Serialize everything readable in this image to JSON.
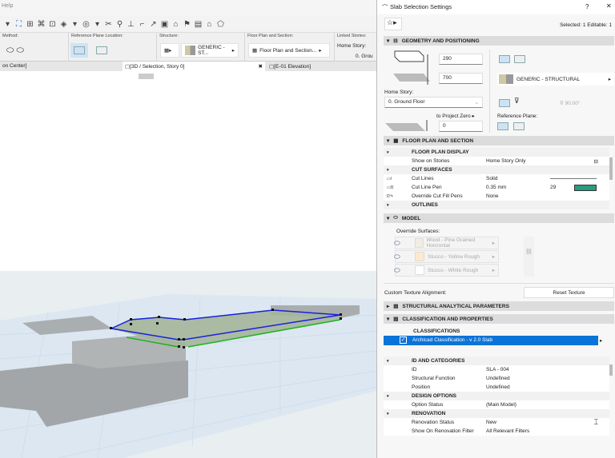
{
  "app": {
    "menu": [
      "Help"
    ],
    "infobox": {
      "method_label": "Method:",
      "ref_plane_label": "Reference Plane Location:",
      "structure_label": "Structure:",
      "structure_value": "GENERIC - ST...",
      "fps_label": "Floor Plan and Section:",
      "fps_value": "Floor Plan and Section...",
      "linked_label": "Linked Stories:",
      "home_story_label": "Home Story:",
      "home_story_value": "0. Grou"
    },
    "tabs": [
      {
        "label": "on Center]"
      },
      {
        "label": "[3D / Selection, Story 0]",
        "active": true
      },
      {
        "label": "[E-01 Elevation]"
      }
    ],
    "close_glyph": "✖"
  },
  "dialog": {
    "title": "Slab Selection Settings",
    "help": "?",
    "close": "✕",
    "selected": "Selected: 1 Editable: 1",
    "geometry": {
      "header": "GEOMETRY AND POSITIONING",
      "thickness": "290",
      "offset": "700",
      "home_story_label": "Home Story:",
      "home_story": "0. Ground Floor",
      "to_project_zero": "to Project Zero",
      "elevation": "0",
      "structure": "GENERIC - STRUCTURAL",
      "angle": "90.00°",
      "ref_plane_label": "Reference Plane:"
    },
    "floorplan": {
      "header": "FLOOR PLAN AND SECTION",
      "rows": [
        {
          "type": "group",
          "label": "FLOOR PLAN DISPLAY"
        },
        {
          "label": "Show on Stories",
          "value": "Home Story Only"
        },
        {
          "type": "group",
          "label": "CUT SURFACES"
        },
        {
          "label": "Cut Lines",
          "value": "Solid"
        },
        {
          "label": "Cut Line Pen",
          "value": "0.35 mm",
          "extra": "29"
        },
        {
          "label": "Override Cut Fill Pens",
          "value": "None"
        },
        {
          "type": "group",
          "label": "OUTLINES"
        }
      ]
    },
    "model": {
      "header": "MODEL",
      "override_label": "Override Surfaces:",
      "surfaces": [
        {
          "name": "Wood - Pine Grained Horizontal",
          "color": "#f3ece2"
        },
        {
          "name": "Stucco - Yellow Rough",
          "color": "#fde9cc"
        },
        {
          "name": "Stucco - White Rough",
          "color": "#ffffff"
        }
      ],
      "custom_texture_label": "Custom Texture Alignment:",
      "reset_texture": "Reset Texture"
    },
    "structural": {
      "header": "STRUCTURAL ANALYTICAL PARAMETERS"
    },
    "classification": {
      "header": "CLASSIFICATION AND PROPERTIES",
      "classifications_label": "CLASSIFICATIONS",
      "selected_item": "Archicad Classification - v 2.0  Slab",
      "accent": "#0a74d8",
      "rows": [
        {
          "type": "group",
          "label": "ID AND CATEGORIES"
        },
        {
          "label": "ID",
          "value": "SLA - 004"
        },
        {
          "label": "Structural Function",
          "value": "Undefined"
        },
        {
          "label": "Position",
          "value": "Undefined"
        },
        {
          "type": "group",
          "label": "DESIGN OPTIONS"
        },
        {
          "label": "Option Status",
          "value": "(Main Model)"
        },
        {
          "type": "group",
          "label": "RENOVATION"
        },
        {
          "label": "Renovation Status",
          "value": "New"
        },
        {
          "label": "Show On Renovation Filter",
          "value": "All Relevant Filters"
        }
      ]
    }
  }
}
